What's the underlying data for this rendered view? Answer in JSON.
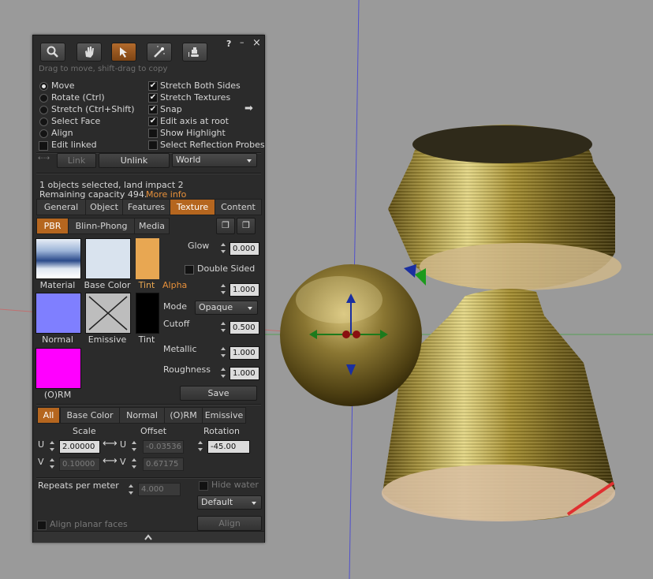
{
  "toolbar": {
    "hint": "Drag to move, shift-drag to copy",
    "help": "?",
    "minimize": "–",
    "close": "×"
  },
  "modes": [
    {
      "label": "Move",
      "selected": true
    },
    {
      "label": "Rotate (Ctrl)",
      "selected": false
    },
    {
      "label": "Stretch (Ctrl+Shift)",
      "selected": false
    },
    {
      "label": "Select Face",
      "selected": false
    },
    {
      "label": "Align",
      "selected": false
    }
  ],
  "edit_linked": {
    "label": "Edit linked",
    "checked": false
  },
  "options": [
    {
      "label": "Stretch Both Sides",
      "checked": true
    },
    {
      "label": "Stretch Textures",
      "checked": true
    },
    {
      "label": "Snap",
      "checked": true
    },
    {
      "label": "Edit axis at root",
      "checked": true
    },
    {
      "label": "Show Highlight",
      "checked": false
    },
    {
      "label": "Select Reflection Probes",
      "checked": false
    }
  ],
  "link_row": {
    "link": "Link",
    "unlink": "Unlink",
    "ref_frame": "World"
  },
  "selection": {
    "info": "1 objects selected, land impact 2",
    "capacity": "Remaining capacity 494.",
    "more_info": "More info"
  },
  "tabs": [
    "General",
    "Object",
    "Features",
    "Texture",
    "Content"
  ],
  "active_tab": "Texture",
  "material_tabs": [
    "PBR",
    "Blinn-Phong",
    "Media"
  ],
  "swatches": {
    "material": "Material",
    "base_color": "Base Color",
    "tint_top": "Tint",
    "normal": "Normal",
    "emissive": "Emissive",
    "tint_bottom": "Tint",
    "orm": "(O)RM"
  },
  "props": {
    "glow_label": "Glow",
    "glow": "0.000",
    "double_sided": "Double Sided",
    "alpha_label": "Alpha",
    "alpha": "1.000",
    "mode_label": "Mode",
    "mode": "Opaque",
    "cutoff_label": "Cutoff",
    "cutoff": "0.500",
    "metallic_label": "Metallic",
    "metallic": "1.000",
    "roughness_label": "Roughness",
    "roughness": "1.000",
    "save": "Save"
  },
  "channel_tabs": [
    "All",
    "Base Color",
    "Normal",
    "(O)RM",
    "Emissive"
  ],
  "transform": {
    "scale_label": "Scale",
    "offset_label": "Offset",
    "rotation_label": "Rotation",
    "u": "U",
    "v": "V",
    "scale_u": "2.00000",
    "scale_v": "0.10000",
    "offset_u": "-0.03536",
    "offset_v": "0.67175",
    "rotation": "-45.00"
  },
  "repeats": {
    "label": "Repeats per meter",
    "value": "4.000"
  },
  "hide_water": "Hide water",
  "mapping": "Default",
  "align_planar": "Align planar faces",
  "align_button": "Align",
  "colors": {
    "accent": "#b5661f",
    "tint": "#e8a752",
    "normal": "#7f7fff",
    "orm": "#ff00ff"
  }
}
